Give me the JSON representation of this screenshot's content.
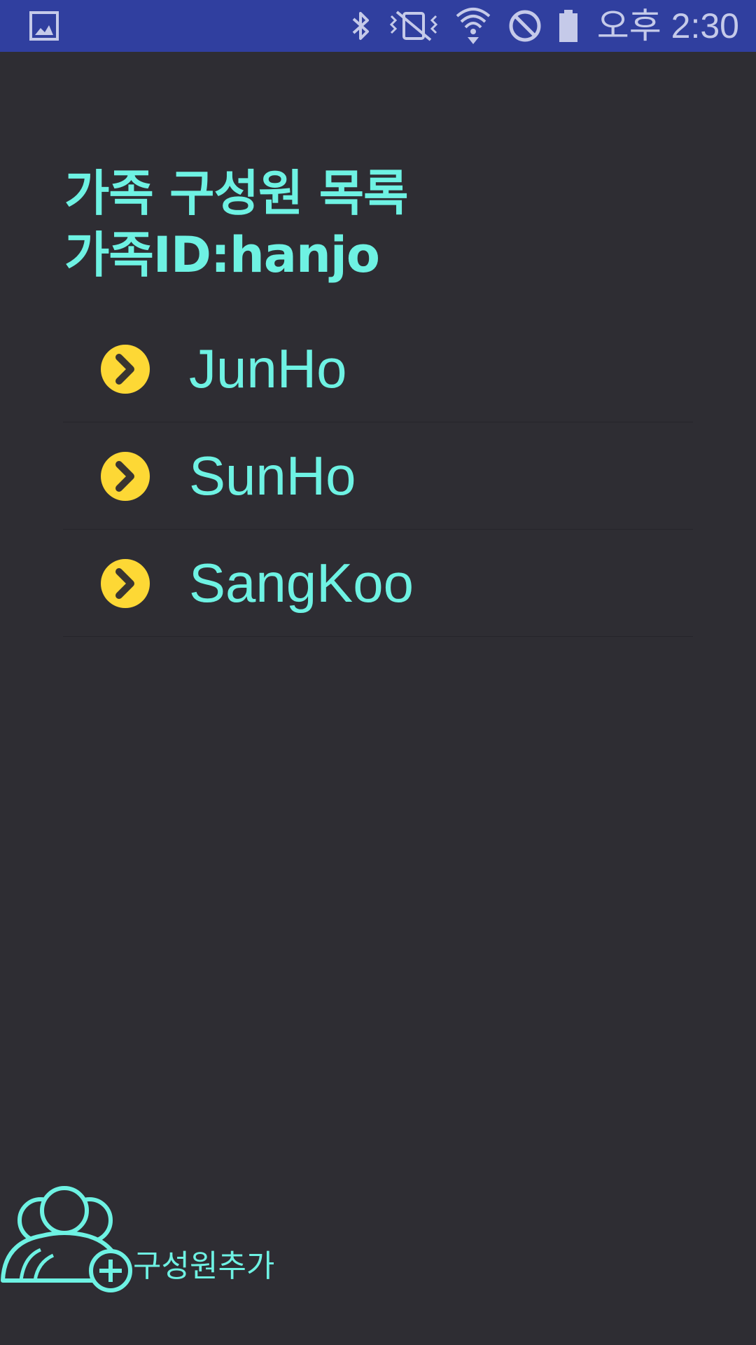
{
  "status_bar": {
    "time": "오후 2:30",
    "icons": [
      "gallery-icon",
      "bluetooth-icon",
      "vibrate-icon",
      "wifi-icon",
      "do-not-disturb-icon",
      "battery-icon"
    ]
  },
  "header": {
    "title": "가족 구성원 목록",
    "family_id": "가족ID:hanjo"
  },
  "members": [
    {
      "name": "JunHo"
    },
    {
      "name": "SunHo"
    },
    {
      "name": "SangKoo"
    }
  ],
  "add_member": {
    "label": "구성원추가"
  },
  "colors": {
    "background": "#2e2d33",
    "status_bar": "#303f9f",
    "accent": "#6ef2e3",
    "chevron": "#fdd835"
  }
}
